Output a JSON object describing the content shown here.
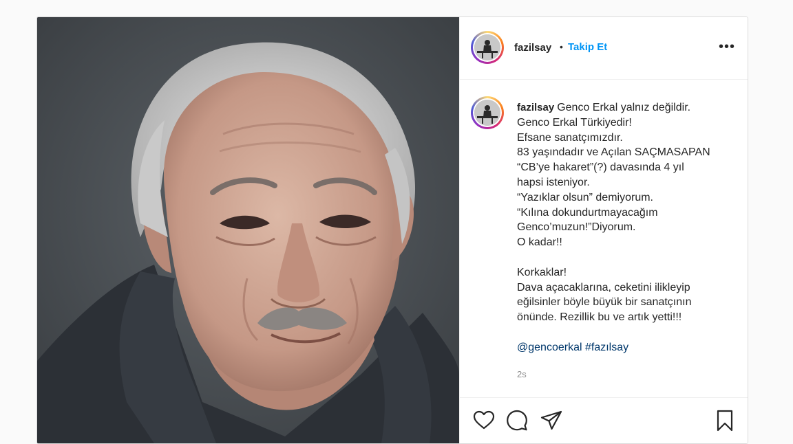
{
  "post": {
    "username": "fazilsay",
    "dot": "•",
    "follow_label": "Takip Et",
    "more_label": "•••",
    "caption_lines": [
      "Genco Erkal yalnız değildir.",
      "Genco Erkal Türkiyedir!",
      "Efsane sanatçımızdır.",
      "83 yaşındadır ve Açılan SAÇMASAPAN",
      "“CB’ye hakaret”(?) davasında 4 yıl",
      "hapsi isteniyor.",
      "“Yazıklar olsun” demiyorum.",
      "“Kılına dokundurtmayacağım",
      "Genco’muzun!”Diyorum.",
      "O kadar!!",
      "",
      "Korkaklar!",
      "Dava açacaklarına, ceketini ilikleyip",
      "eğilsinler böyle büyük bir sanatçının",
      "önünde. Rezillik bu ve artık yetti!!!",
      ""
    ],
    "tag_mention": "@gencoerkal",
    "tag_hashtag": "#fazılsay",
    "time": "2s"
  },
  "icons": {
    "like": "heart-icon",
    "comment": "comment-icon",
    "share": "paper-plane-icon",
    "save": "bookmark-icon",
    "more": "more-options-icon"
  },
  "colors": {
    "accent": "#0095f6",
    "text": "#262626",
    "muted": "#8e8e8e",
    "link": "#00376b",
    "border": "#dbdbdb"
  }
}
